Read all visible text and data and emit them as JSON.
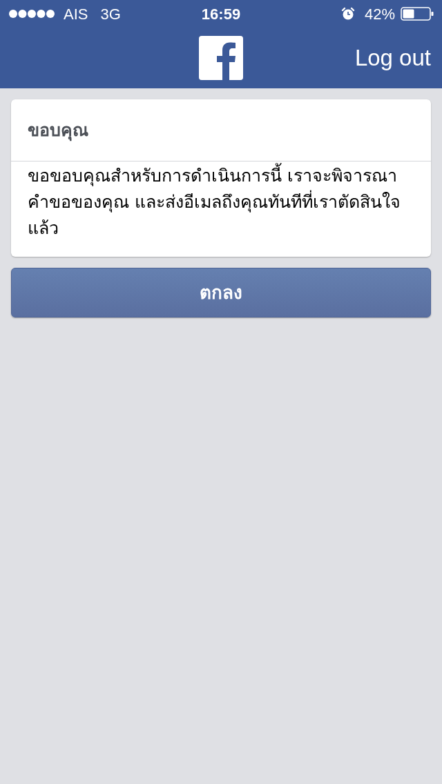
{
  "status_bar": {
    "carrier": "AIS",
    "network": "3G",
    "time": "16:59",
    "battery": "42%"
  },
  "nav_bar": {
    "action": "Log out"
  },
  "card": {
    "title": "ขอบคุณ",
    "message": "ขอขอบคุณสำหรับการดำเนินการนี้ เราจะพิจารณาคำขอของคุณ และส่งอีเมลถึงคุณทันทีที่เราตัดสินใจแล้ว"
  },
  "buttons": [
    "ตกลง"
  ]
}
